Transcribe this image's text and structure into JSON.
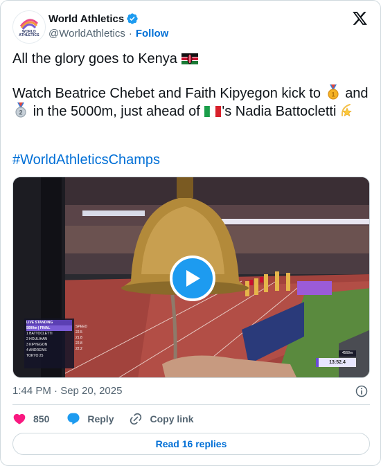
{
  "author": {
    "display_name": "World Athletics",
    "handle": "@WorldAthletics",
    "follow_label": "Follow",
    "verified": true,
    "avatar_text_line1": "WORLD",
    "avatar_text_line2": "ATHLETICS"
  },
  "tweet": {
    "line1": "All the glory goes to Kenya",
    "para2_part1": "Watch Beatrice Chebet and Faith Kipyegon kick to",
    "para2_part2": "and",
    "para2_part3": "in the 5000m, just ahead of",
    "para2_part4": "'s Nadia Battocletti",
    "hashtag": "#WorldAthleticsChamps"
  },
  "media": {
    "board_title": "LIVE STANDING",
    "board_event": "5000m | FINAL",
    "board_rows": [
      {
        "pos": "1",
        "name": "BATTOCLETTI",
        "speed": "22.5"
      },
      {
        "pos": "2",
        "name": "HOULIHAN",
        "speed": "21.8"
      },
      {
        "pos": "3",
        "name": "KIPYEGON",
        "speed": "22.8"
      },
      {
        "pos": "4",
        "name": "ANDREWS",
        "speed": "22.2"
      }
    ],
    "board_footer": "TOKYO 25",
    "speed_header": "SPEED",
    "timer_top": "4568m",
    "timer": "13:52.4"
  },
  "meta": {
    "timestamp": "1:44 PM · Sep 20, 2025"
  },
  "actions": {
    "like_count": "850",
    "reply_label": "Reply",
    "copy_link_label": "Copy link",
    "read_replies_label": "Read 16 replies"
  },
  "colors": {
    "link": "#006fd6",
    "like_heart": "#f91880",
    "play_button": "#1d9bf0",
    "secondary_text": "#536471"
  },
  "icons": [
    "verified-badge-icon",
    "x-logo-icon",
    "kenya-flag-icon",
    "gold-medal-icon",
    "silver-medal-icon",
    "italy-flag-icon",
    "dizzy-star-icon",
    "play-icon",
    "info-icon",
    "heart-icon",
    "reply-icon",
    "link-icon"
  ]
}
